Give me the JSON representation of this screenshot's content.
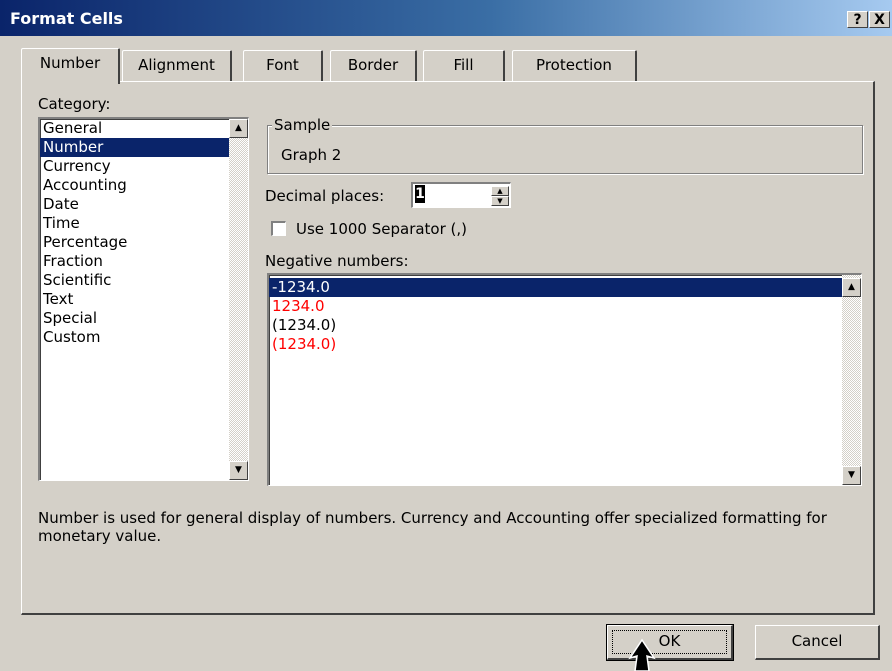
{
  "window": {
    "title": "Format Cells",
    "help_label": "?",
    "close_label": "X"
  },
  "tabs": [
    {
      "label": "Number"
    },
    {
      "label": "Alignment"
    },
    {
      "label": "Font"
    },
    {
      "label": "Border"
    },
    {
      "label": "Fill"
    },
    {
      "label": "Protection"
    }
  ],
  "category": {
    "label": "Category:",
    "selected": "Number",
    "items": [
      "General",
      "Number",
      "Currency",
      "Accounting",
      "Date",
      "Time",
      "Percentage",
      "Fraction",
      "Scientific",
      "Text",
      "Special",
      "Custom"
    ]
  },
  "sample": {
    "label": "Sample",
    "value": "Graph 2"
  },
  "decimal_places": {
    "label": "Decimal places:",
    "value": "1"
  },
  "separator": {
    "label": "Use 1000 Separator (,)",
    "checked": false
  },
  "negative_numbers": {
    "label": "Negative numbers:",
    "items": [
      {
        "text": "-1234.0",
        "color": "#000000",
        "selected": true
      },
      {
        "text": "1234.0",
        "color": "#ff0000",
        "selected": false
      },
      {
        "text": "(1234.0)",
        "color": "#000000",
        "selected": false
      },
      {
        "text": "(1234.0)",
        "color": "#ff0000",
        "selected": false
      }
    ]
  },
  "description": "Number is used for general display of numbers.  Currency and Accounting offer specialized formatting for monetary value.",
  "buttons": {
    "ok": "OK",
    "cancel": "Cancel"
  },
  "colors": {
    "title_bar": "#0a246a",
    "selection": "#0a246a",
    "dialog_bg": "#d4d0c8",
    "negative_red": "#ff0000"
  },
  "icons": {
    "scroll_up": "triangle-up-icon",
    "scroll_down": "triangle-down-icon",
    "cursor": "arrow-cursor-icon"
  }
}
